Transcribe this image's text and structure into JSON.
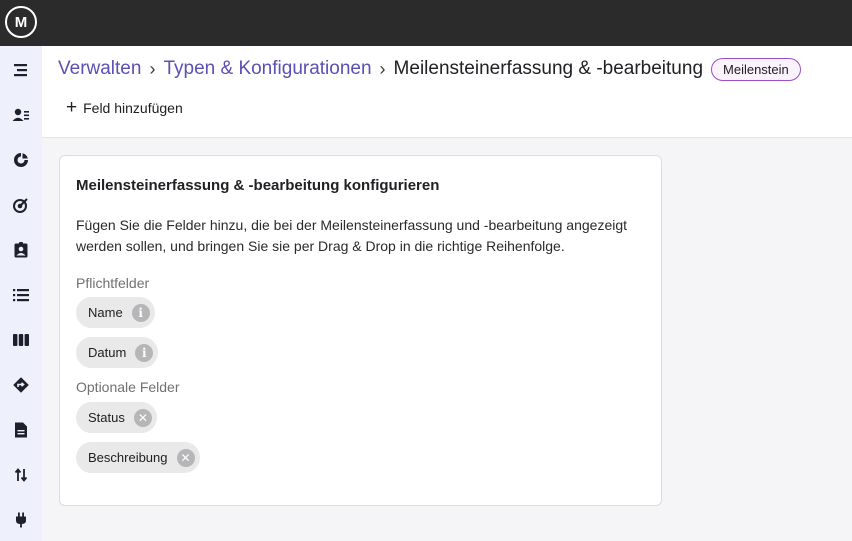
{
  "app": {
    "logo_text": "M"
  },
  "sidebar": {
    "items": [
      {
        "name": "menu-icon"
      },
      {
        "name": "users-icon"
      },
      {
        "name": "chart-icon"
      },
      {
        "name": "target-icon"
      },
      {
        "name": "clipboard-user-icon"
      },
      {
        "name": "list-icon"
      },
      {
        "name": "board-icon"
      },
      {
        "name": "roadmap-icon"
      },
      {
        "name": "document-icon"
      },
      {
        "name": "sort-icon"
      },
      {
        "name": "plug-icon"
      }
    ]
  },
  "breadcrumb": {
    "items": [
      "Verwalten",
      "Typen & Konfigurationen"
    ],
    "current": "Meilensteinerfassung & -bearbeitung",
    "badge": "Meilenstein"
  },
  "toolbar": {
    "add_field_label": "Feld hinzufügen"
  },
  "card": {
    "title": "Meilensteinerfassung & -bearbeitung konfigurieren",
    "description": "Fügen Sie die Felder hinzu, die bei der Meilensteinerfassung und -bearbeitung angezeigt werden sollen, und bringen Sie sie per Drag & Drop in die richtige Reihenfolge.",
    "required_label": "Pflichtfelder",
    "required_fields": [
      "Name",
      "Datum"
    ],
    "optional_label": "Optionale Felder",
    "optional_fields": [
      "Status",
      "Beschreibung"
    ]
  },
  "colors": {
    "accent": "#5b4fb4",
    "badge_border": "#9c4fc4",
    "topbar": "#2b2b2b",
    "sidebar": "#eef0fb"
  }
}
